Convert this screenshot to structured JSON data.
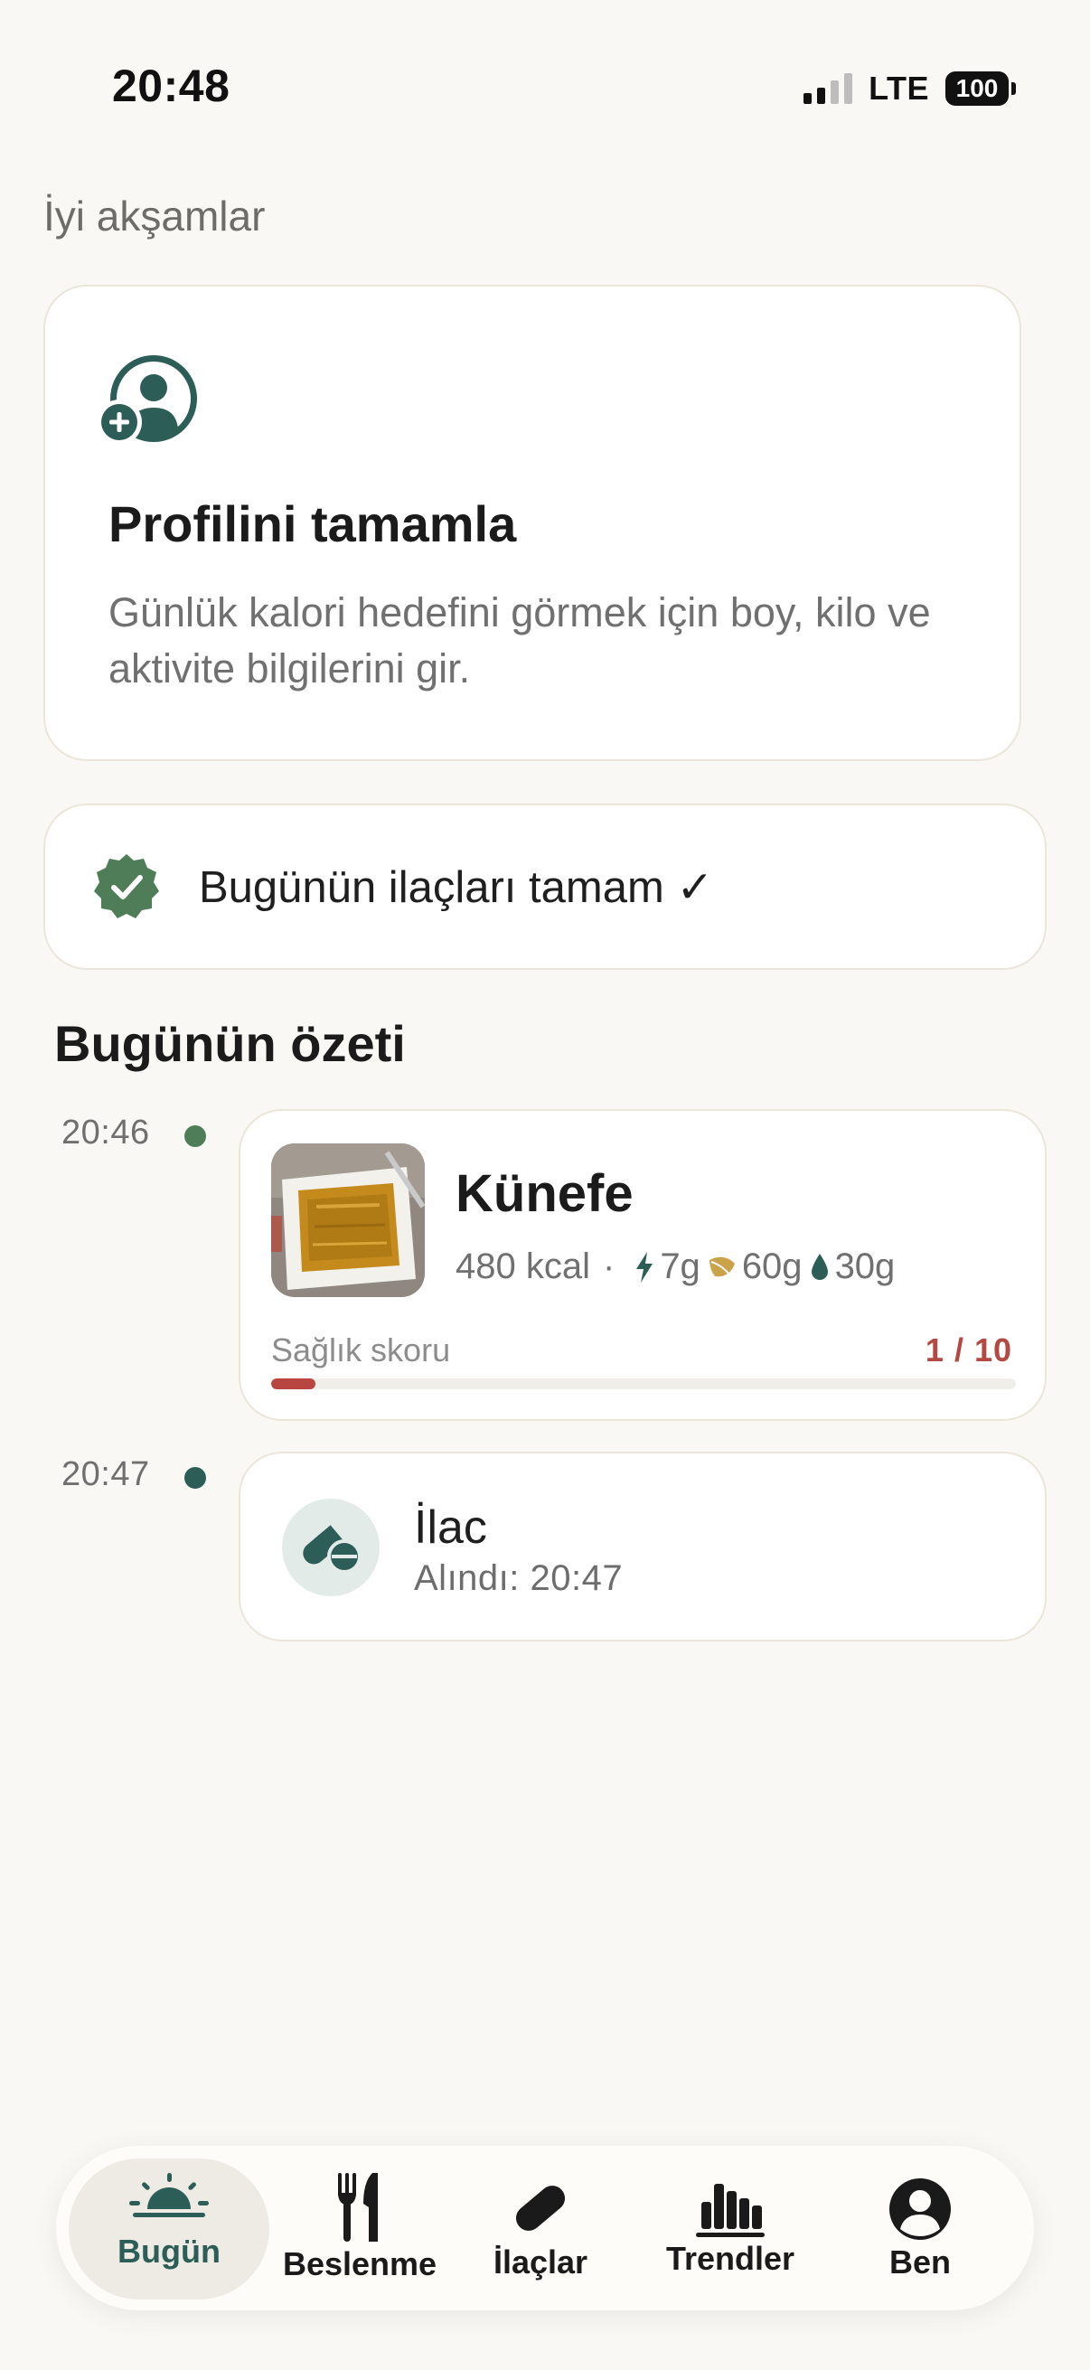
{
  "status_bar": {
    "time": "20:48",
    "network": "LTE",
    "battery": "100"
  },
  "greeting": "İyi akşamlar",
  "profile_card": {
    "icon": "user-plus-icon",
    "title": "Profilini tamamla",
    "description": "Günlük kalori hedefini görmek için boy, kilo ve aktivite bilgilerini gir."
  },
  "meds_status": {
    "icon": "check-badge-icon",
    "text": "Bugünün ilaçları tamam ✓"
  },
  "summary": {
    "title": "Bugünün özeti",
    "entries": [
      {
        "time": "20:46",
        "type": "meal",
        "name": "Künefe",
        "kcal": "480 kcal",
        "separator": "·",
        "protein": "7g",
        "carbs": "60g",
        "fat": "30g",
        "score_label": "Sağlık skoru",
        "score_text": "1 / 10",
        "score_fraction": 0.1
      },
      {
        "time": "20:47",
        "type": "medication",
        "name": "İlac",
        "taken": "Alındı: 20:47"
      }
    ]
  },
  "nav": {
    "items": [
      {
        "label": "Bugün",
        "icon": "sunset-icon",
        "active": true
      },
      {
        "label": "Beslenme",
        "icon": "fork-knife-icon",
        "active": false
      },
      {
        "label": "İlaçlar",
        "icon": "pill-icon",
        "active": false
      },
      {
        "label": "Trendler",
        "icon": "bar-chart-icon",
        "active": false
      },
      {
        "label": "Ben",
        "icon": "user-circle-icon",
        "active": false
      }
    ]
  },
  "colors": {
    "background": "#f9f8f4",
    "accent": "#2c5e57",
    "success": "#4f7d58",
    "score_red": "#b8453f"
  }
}
